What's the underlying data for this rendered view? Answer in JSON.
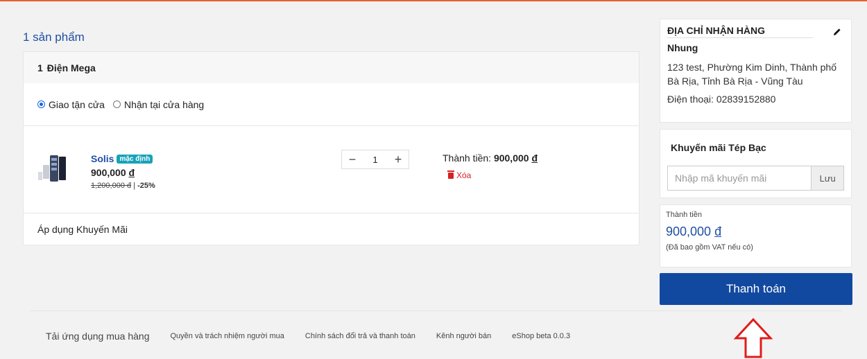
{
  "cart": {
    "count_label": "1 sản phẩm",
    "shop": {
      "index": "1",
      "name": "Điện Mega"
    },
    "delivery_options": [
      "Giao tận cửa",
      "Nhận tại cửa hàng"
    ],
    "delivery_selected": "Giao tận cửa",
    "item": {
      "name": "Solis",
      "badge": "mặc định",
      "price": "900,000",
      "currency": "đ",
      "old_price": "1,200,000 đ",
      "discount": "-25%",
      "quantity": "1",
      "total_label": "Thành tiền:",
      "total_value": "900,000",
      "delete_label": "Xóa"
    },
    "apply_promo_label": "Áp dụng Khuyến Mãi"
  },
  "address": {
    "title": "ĐỊA CHỈ NHẬN HÀNG",
    "name": "Nhung",
    "line": "123 test, Phường Kim Dinh, Thành phố Bà Rịa, Tỉnh Bà Rịa - Vũng Tàu",
    "phone": "Điện thoại: 02839152880"
  },
  "promo": {
    "title": "Khuyến mãi Tép Bạc",
    "placeholder": "Nhập mã khuyến mãi",
    "save_label": "Lưu"
  },
  "summary": {
    "label": "Thành tiền",
    "value": "900,000",
    "currency": "đ",
    "note": "(Đã bao gồm VAT nếu có)"
  },
  "checkout_label": "Thanh toán",
  "footer": {
    "download": "Tải ứng dụng mua hàng",
    "links": [
      "Quyền và trách nhiệm người mua",
      "Chính sách đổi trả và thanh toán",
      "Kênh người bán",
      "eShop beta 0.0.3"
    ]
  },
  "colors": {
    "accent": "#1249a0",
    "link": "#1f4fa3",
    "danger": "#d62020",
    "badge": "#17a2b8",
    "topline": "#e8602c"
  }
}
